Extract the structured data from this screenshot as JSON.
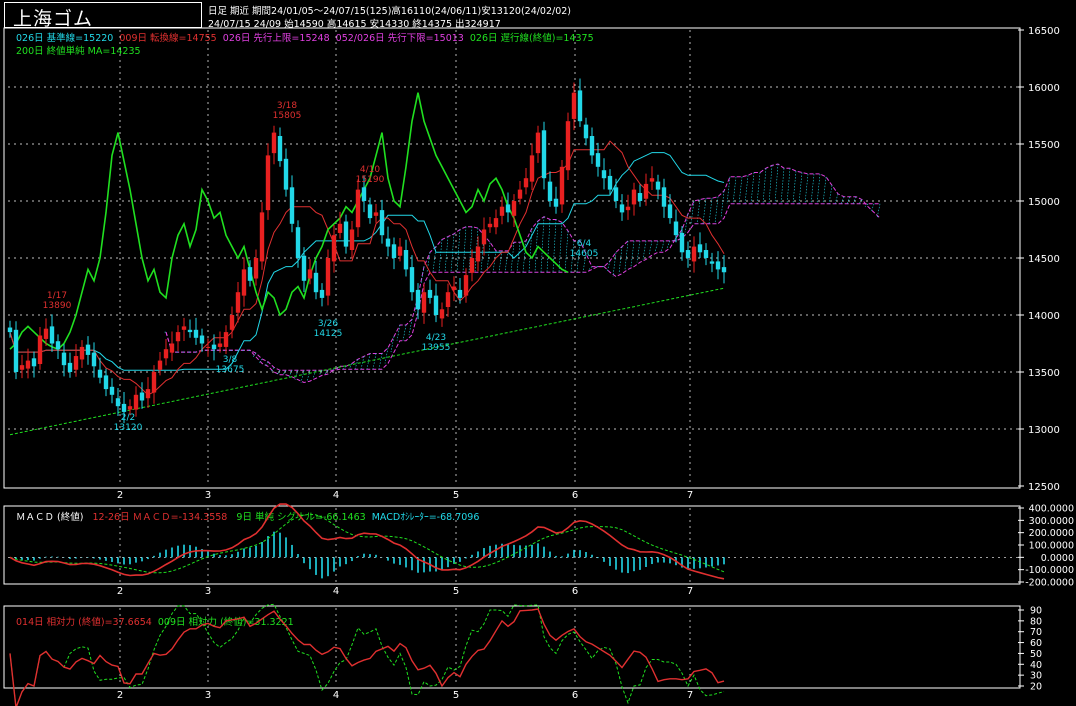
{
  "title": "上海ゴム",
  "header": {
    "line1": "日足  期近   期間24/01/05～24/07/15(125)高16110(24/06/11)安13120(24/02/02)",
    "line2": "24/07/15 24/09  始14590 高14615 安14330 終14375 出324917"
  },
  "main_legend": {
    "row1": [
      {
        "text": "026日 基準線=15220",
        "color": "#22d8e8"
      },
      {
        "text": "009日 転換線=14755",
        "color": "#e03030"
      },
      {
        "text": "026日 先行上限=15248",
        "color": "#e040e0"
      },
      {
        "text": "052/026日 先行下限=15013",
        "color": "#e040e0"
      },
      {
        "text": "026日 遅行線(終値)=14375",
        "color": "#20e020"
      }
    ],
    "row2": [
      {
        "text": "200日 終値単純 MA=14235",
        "color": "#20e020"
      }
    ]
  },
  "macd_legend": [
    {
      "text": "ＭＡＣＤ (終値)",
      "color": "#ffffff"
    },
    {
      "text": "12-26日 ＭＡＣＤ=-134.3558",
      "color": "#e03030"
    },
    {
      "text": "9日 単純 シグナル=-66.1463",
      "color": "#20e020"
    },
    {
      "text": "MACDｵｼﾚｰﾀｰ=-68.7096",
      "color": "#22d8e8"
    }
  ],
  "rsi_legend": [
    {
      "text": "014日 相対力 (終値)=37.6654",
      "color": "#e03030"
    },
    {
      "text": "009日 相対力 (終値)=31.3221",
      "color": "#20e020"
    }
  ],
  "colors": {
    "up": "#e82020",
    "down": "#22d8e8",
    "kijun": "#22d8e8",
    "tenkan": "#e03030",
    "span": "#e040e0",
    "chikou": "#20e020",
    "ma200": "#20e020",
    "grid": "#ffffff",
    "macd": "#e03030",
    "signal": "#20e020",
    "rsi14": "#e03030",
    "rsi9": "#20e020"
  },
  "chart_data": [
    {
      "type": "candlestick",
      "name": "price",
      "x_ticks": [
        "2",
        "3",
        "4",
        "5",
        "6",
        "7"
      ],
      "y_ticks": [
        "16500",
        "16000",
        "15500",
        "15000",
        "14500",
        "14000",
        "13500",
        "13000",
        "12500"
      ],
      "ylim": [
        12500,
        16500
      ],
      "annotations": [
        {
          "date": "1/17",
          "value": "13890",
          "color": "#e03030"
        },
        {
          "date": "3/18",
          "value": "15805",
          "color": "#e03030"
        },
        {
          "date": "4/10",
          "value": "15190",
          "color": "#e03030"
        },
        {
          "date": "2/2",
          "value": "13120",
          "color": "#22d8e8"
        },
        {
          "date": "3/8",
          "value": "13675",
          "color": "#22d8e8"
        },
        {
          "date": "3/26",
          "value": "14125",
          "color": "#22d8e8"
        },
        {
          "date": "4/23",
          "value": "13955",
          "color": "#22d8e8"
        },
        {
          "date": "6/4",
          "value": "14605",
          "color": "#22d8e8"
        }
      ],
      "closes": [
        13850,
        13500,
        13560,
        13600,
        13550,
        13820,
        13880,
        13750,
        13700,
        13560,
        13500,
        13640,
        13720,
        13650,
        13550,
        13450,
        13350,
        13300,
        13200,
        13150,
        13200,
        13300,
        13250,
        13350,
        13500,
        13600,
        13700,
        13750,
        13850,
        13900,
        13850,
        13800,
        13750,
        13720,
        13700,
        13750,
        13850,
        14000,
        14200,
        14400,
        14300,
        14500,
        14900,
        15400,
        15600,
        15350,
        15100,
        14800,
        14500,
        14300,
        14400,
        14200,
        14150,
        14500,
        14700,
        14800,
        14600,
        14750,
        15100,
        15000,
        14850,
        14900,
        14700,
        14600,
        14500,
        14600,
        14400,
        14200,
        14050,
        14200,
        14150,
        14000,
        14050,
        14200,
        14250,
        14150,
        14350,
        14500,
        14600,
        14750,
        14800,
        14850,
        14950,
        14900,
        15000,
        15100,
        15200,
        15400,
        15600,
        15200,
        15000,
        14950,
        15300,
        15700,
        15950,
        15700,
        15550,
        15400,
        15300,
        15200,
        15100,
        15000,
        14900,
        14950,
        15100,
        15000,
        15150,
        15200,
        15100,
        14950,
        14850,
        14700,
        14550,
        14500,
        14600,
        14550,
        14500,
        14450,
        14400,
        14375
      ],
      "macd": {
        "ylim": [
          -200,
          400
        ],
        "y_ticks": [
          "400.0000",
          "300.0000",
          "200.0000",
          "100.0000",
          "0.0000",
          "-100.0000",
          "-200.0000"
        ]
      },
      "rsi": {
        "ylim": [
          20,
          90
        ],
        "y_ticks": [
          "90",
          "80",
          "70",
          "60",
          "50",
          "40",
          "30",
          "20"
        ]
      }
    }
  ]
}
